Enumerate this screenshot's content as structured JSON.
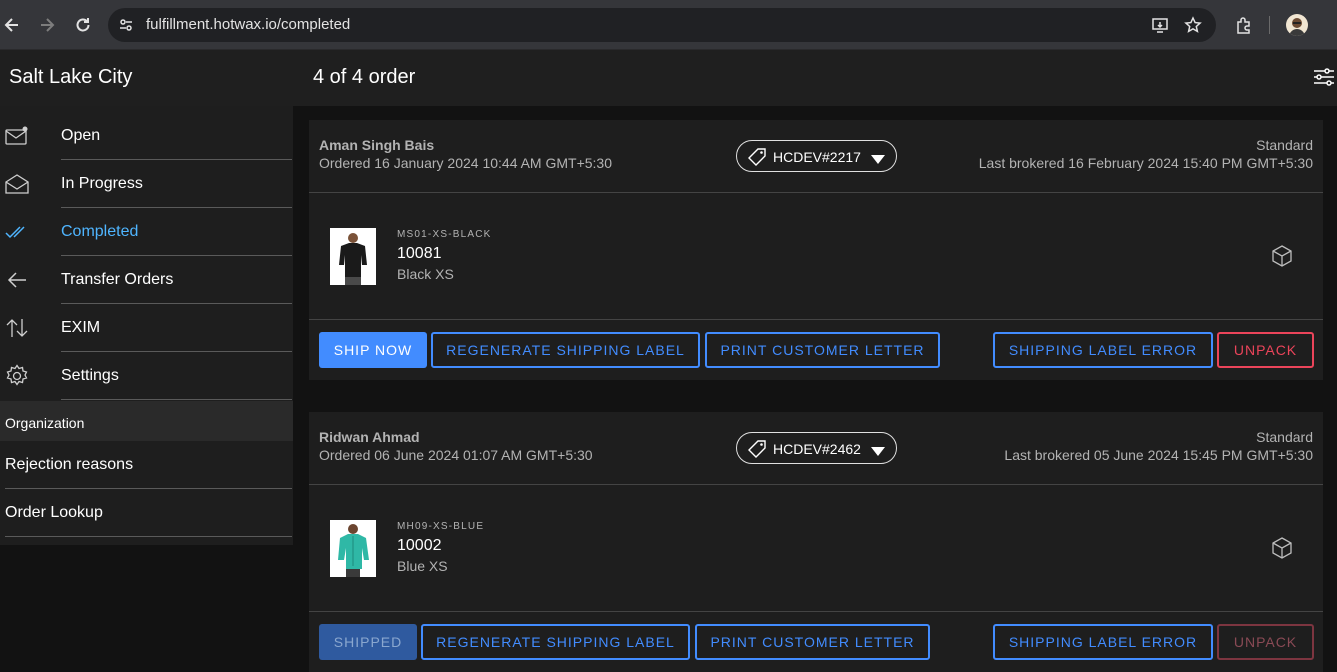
{
  "browser": {
    "url": "fulfillment.hotwax.io/completed",
    "icons": [
      "back-arrow-icon",
      "forward-arrow-icon",
      "reload-icon",
      "site-info-icon",
      "install-app-icon",
      "bookmark-star-icon",
      "extensions-icon",
      "profile-avatar"
    ]
  },
  "header": {
    "store_name": "Salt Lake City",
    "order_count": "4 of 4 order"
  },
  "sidebar": {
    "items": [
      {
        "label": "Open",
        "icon": "mail-unread-icon"
      },
      {
        "label": "In Progress",
        "icon": "mail-open-icon"
      },
      {
        "label": "Completed",
        "icon": "checkmark-done-icon",
        "active": true
      },
      {
        "label": "Transfer Orders",
        "icon": "arrow-back-icon"
      },
      {
        "label": "EXIM",
        "icon": "swap-vertical-icon"
      },
      {
        "label": "Settings",
        "icon": "settings-gear-icon"
      }
    ],
    "org_header": "Organization",
    "org_items": [
      {
        "label": "Rejection reasons"
      },
      {
        "label": "Order Lookup"
      }
    ]
  },
  "orders": [
    {
      "customer": "Aman Singh Bais",
      "ordered": "Ordered 16 January 2024 10:44 AM GMT+5:30",
      "order_id": "HCDEV#2217",
      "method": "Standard",
      "brokered": "Last brokered 16 February 2024 15:40 PM GMT+5:30",
      "item": {
        "sku": "MS01-XS-BLACK",
        "product_id": "10081",
        "variant": "Black XS"
      },
      "actions": {
        "ship": "SHIP NOW",
        "regenerate": "REGENERATE SHIPPING LABEL",
        "print": "PRINT CUSTOMER LETTER",
        "label_error": "SHIPPING LABEL ERROR",
        "unpack": "UNPACK"
      }
    },
    {
      "customer": "Ridwan Ahmad",
      "ordered": "Ordered 06 June 2024 01:07 AM GMT+5:30",
      "order_id": "HCDEV#2462",
      "method": "Standard",
      "brokered": "Last brokered 05 June 2024 15:45 PM GMT+5:30",
      "item": {
        "sku": "MH09-XS-BLUE",
        "product_id": "10002",
        "variant": "Blue XS"
      },
      "actions": {
        "ship": "SHIPPED",
        "regenerate": "REGENERATE SHIPPING LABEL",
        "print": "PRINT CUSTOMER LETTER",
        "label_error": "SHIPPING LABEL ERROR",
        "unpack": "UNPACK"
      }
    }
  ],
  "colors": {
    "accent": "#428cff",
    "active_nav": "#4fb5ff",
    "danger": "#eb445a"
  }
}
